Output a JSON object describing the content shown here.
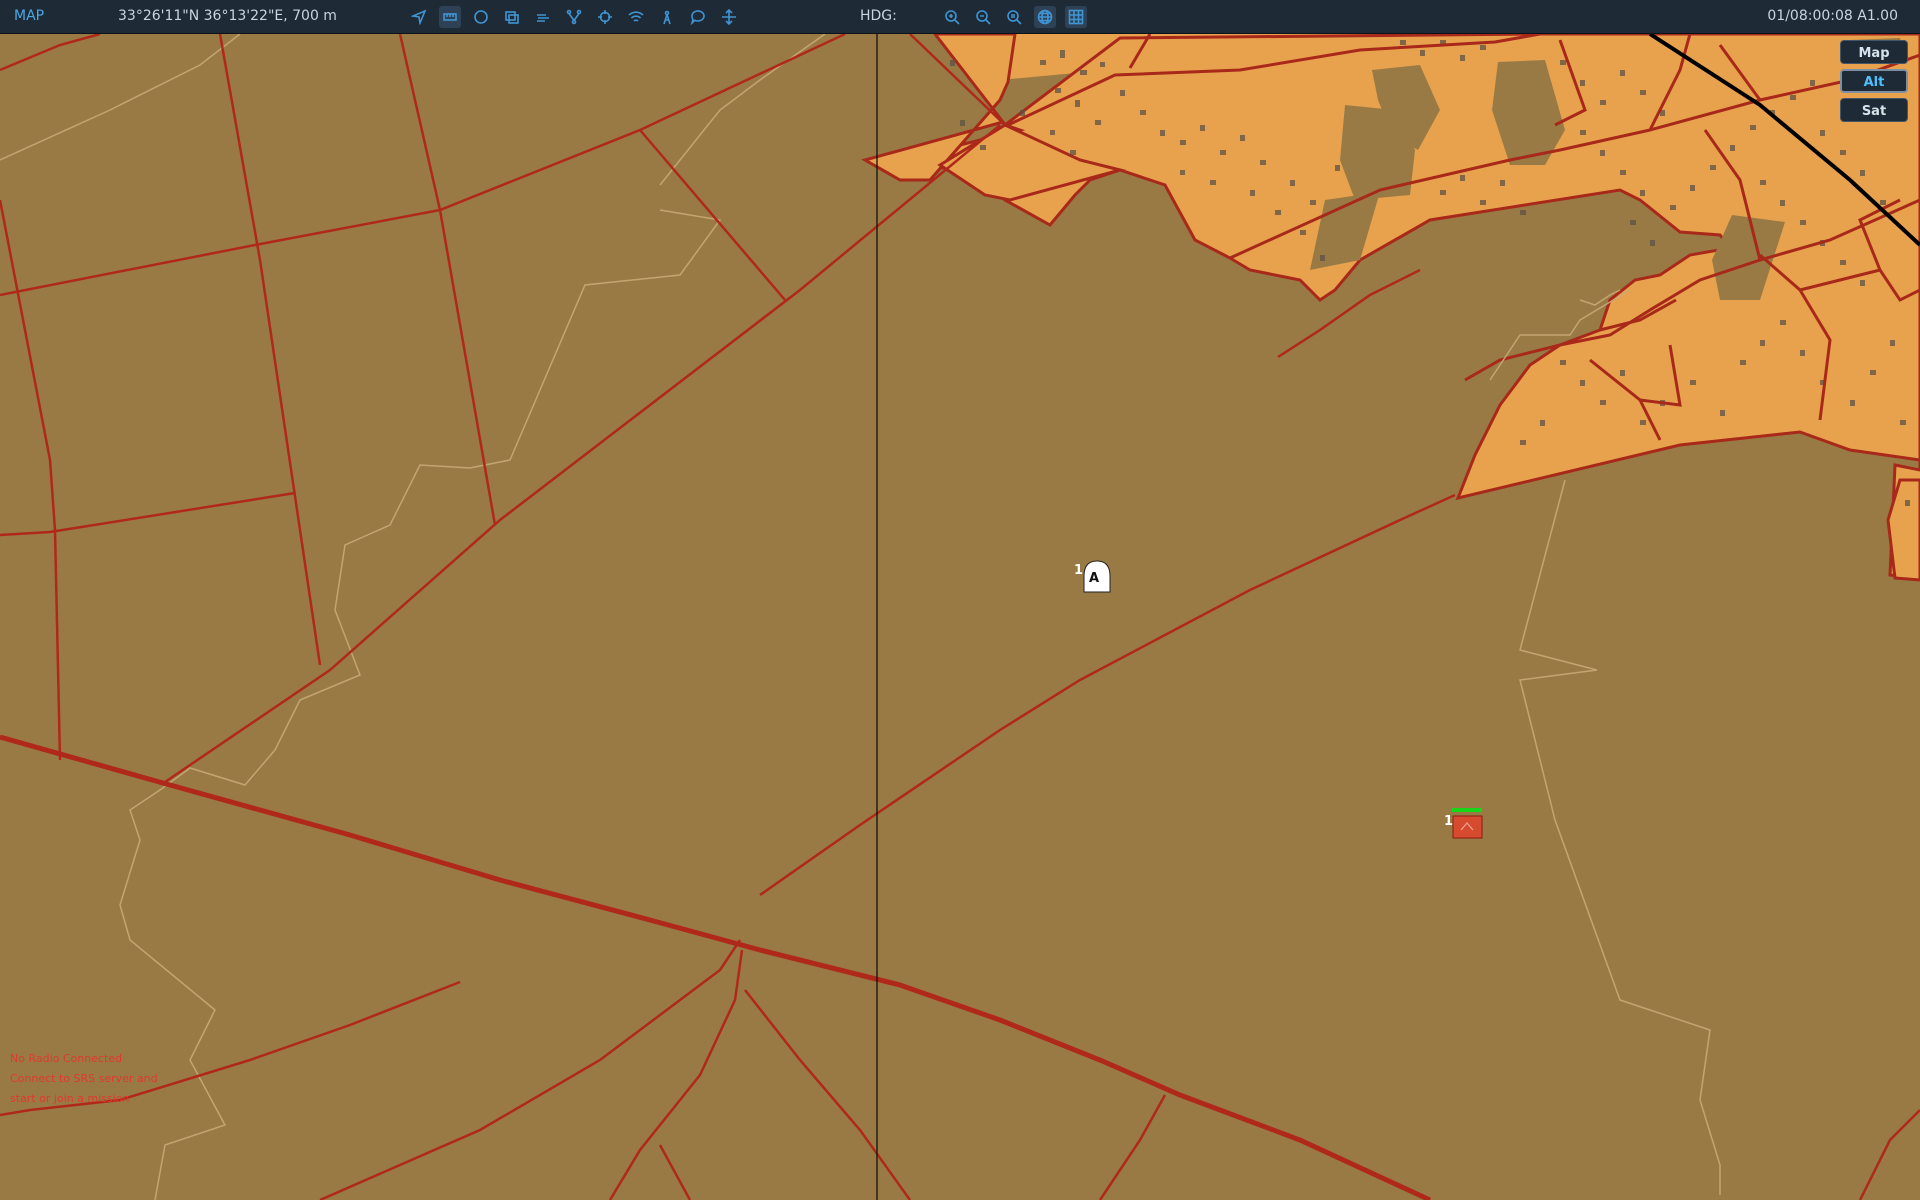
{
  "topbar": {
    "mode": "MAP",
    "coordinates": "33°26'11\"N 36°13'22\"E, 700 m",
    "heading_label": "HDG:",
    "clock": "01/08:00:08 A1.00",
    "tools": [
      "navigate-icon",
      "ruler-icon",
      "circle-icon",
      "layers-icon",
      "weather-icon",
      "network-icon",
      "target-icon",
      "wifi-icon",
      "radio-tower-icon",
      "chat-icon",
      "move-icon"
    ],
    "view_tools": [
      "zoom-in-icon",
      "zoom-out-icon",
      "zoom-fit-icon",
      "globe-icon",
      "grid-icon"
    ]
  },
  "layers": {
    "map": "Map",
    "alt": "Alt",
    "sat": "Sat",
    "selected": "Alt"
  },
  "status": {
    "line1": "No Radio Connected",
    "line2": "Connect to SRS server and",
    "line3": "start or join a mission"
  },
  "units": {
    "friendly": {
      "count": "1",
      "glyph": "A"
    },
    "enemy": {
      "count": "1"
    }
  },
  "colors": {
    "terrain": "#9a7a44",
    "urban": "#e8a24e",
    "road": "#b0281a",
    "enemy": "#d64a30",
    "health": "#18d618",
    "accent": "#4aa8e6"
  }
}
